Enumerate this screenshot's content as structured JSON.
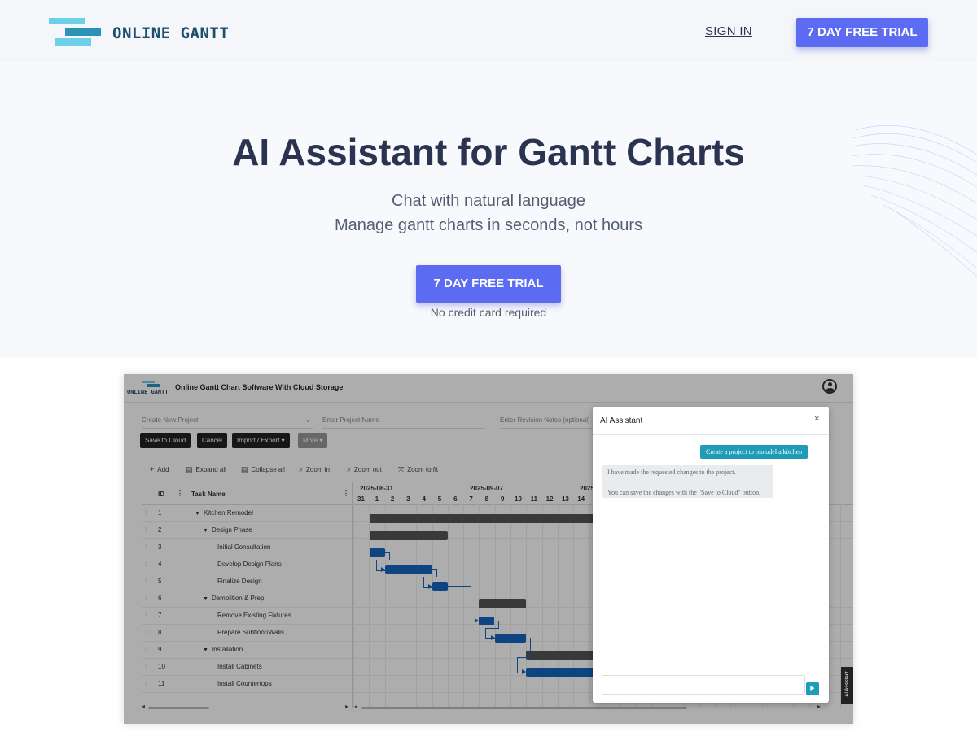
{
  "header": {
    "logo_text": "ONLINE GANTT",
    "signin_label": "SIGN IN",
    "trial_label": "7 DAY FREE TRIAL"
  },
  "hero": {
    "title": "AI Assistant for Gantt Charts",
    "subtitle_line1": "Chat with natural language",
    "subtitle_line2": "Manage gantt charts in seconds, not hours",
    "cta_label": "7 DAY FREE TRIAL",
    "cta_note": "No credit card required"
  },
  "app": {
    "logo_text": "ONLINE GANTT",
    "title": "Online Gantt Chart Software With Cloud Storage",
    "project_select": "Create New Project",
    "project_name_placeholder": "Enter Project Name",
    "revision_notes_placeholder": "Enter Revision Notes (optional)",
    "buttons": {
      "save": "Save to Cloud",
      "cancel": "Cancel",
      "import_export": "Import / Export ▾",
      "more": "More ▾"
    },
    "toolbar": {
      "add": "Add",
      "expand": "Expand all",
      "collapse": "Collapse all",
      "zoom_in": "Zoom in",
      "zoom_out": "Zoom out",
      "zoom_fit": "Zoom to fit"
    },
    "grid": {
      "col_id": "ID",
      "col_name": "Task Name",
      "rows": [
        {
          "id": "1",
          "name": "Kitchen Remodel"
        },
        {
          "id": "2",
          "name": "Design Phase"
        },
        {
          "id": "3",
          "name": "Initial Consultation"
        },
        {
          "id": "4",
          "name": "Develop Design Plans"
        },
        {
          "id": "5",
          "name": "Finalize Design"
        },
        {
          "id": "6",
          "name": "Demolition & Prep"
        },
        {
          "id": "7",
          "name": "Remove Existing Fixtures"
        },
        {
          "id": "8",
          "name": "Prepare Subfloor/Walls"
        },
        {
          "id": "9",
          "name": "Installation"
        },
        {
          "id": "10",
          "name": "Install Cabinets"
        },
        {
          "id": "11",
          "name": "Install Countertops"
        }
      ]
    },
    "timeline": {
      "weeks": [
        "2025-08-31",
        "2025-09-07",
        "2025"
      ],
      "days": [
        "31",
        "1",
        "2",
        "3",
        "4",
        "5",
        "6",
        "7",
        "8",
        "9",
        "10",
        "11",
        "12",
        "13",
        "14"
      ]
    },
    "ai_assistant": {
      "title": "AI Assistant",
      "close": "×",
      "user_message": "Create a project to remodel a kitchen",
      "ai_message_line1": "I have made the requested changes to the project.",
      "ai_message_line2": "You can save the changes with the \"Save to Cloud\" button.",
      "side_tab": "AI Assistant"
    }
  },
  "colors": {
    "primary_button": "#5b6cf2",
    "title_text": "#2a3350",
    "task_bar": "#1565c0",
    "summary_bar": "#555555",
    "chat_accent": "#1e9cb8"
  }
}
